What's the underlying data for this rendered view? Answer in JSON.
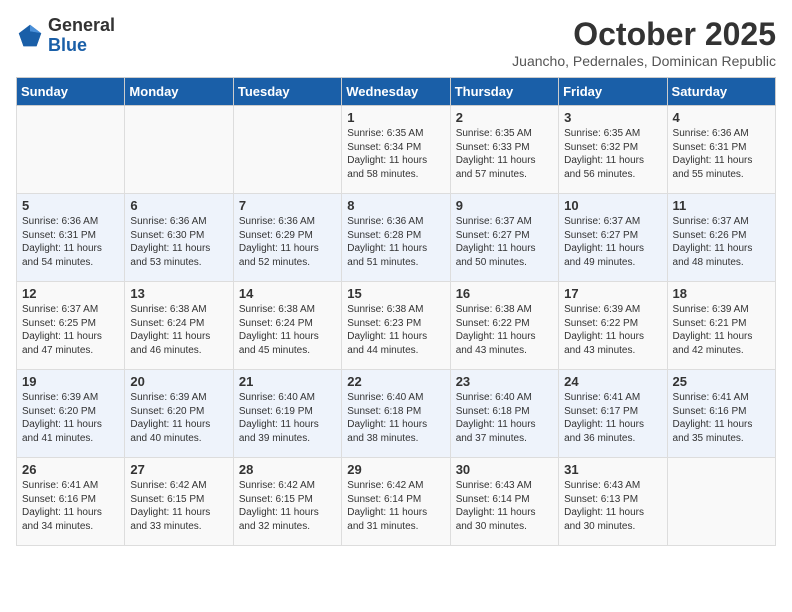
{
  "header": {
    "logo_general": "General",
    "logo_blue": "Blue",
    "month_title": "October 2025",
    "location": "Juancho, Pedernales, Dominican Republic"
  },
  "days_of_week": [
    "Sunday",
    "Monday",
    "Tuesday",
    "Wednesday",
    "Thursday",
    "Friday",
    "Saturday"
  ],
  "weeks": [
    [
      {
        "day": "",
        "info": ""
      },
      {
        "day": "",
        "info": ""
      },
      {
        "day": "",
        "info": ""
      },
      {
        "day": "1",
        "info": "Sunrise: 6:35 AM\nSunset: 6:34 PM\nDaylight: 11 hours\nand 58 minutes."
      },
      {
        "day": "2",
        "info": "Sunrise: 6:35 AM\nSunset: 6:33 PM\nDaylight: 11 hours\nand 57 minutes."
      },
      {
        "day": "3",
        "info": "Sunrise: 6:35 AM\nSunset: 6:32 PM\nDaylight: 11 hours\nand 56 minutes."
      },
      {
        "day": "4",
        "info": "Sunrise: 6:36 AM\nSunset: 6:31 PM\nDaylight: 11 hours\nand 55 minutes."
      }
    ],
    [
      {
        "day": "5",
        "info": "Sunrise: 6:36 AM\nSunset: 6:31 PM\nDaylight: 11 hours\nand 54 minutes."
      },
      {
        "day": "6",
        "info": "Sunrise: 6:36 AM\nSunset: 6:30 PM\nDaylight: 11 hours\nand 53 minutes."
      },
      {
        "day": "7",
        "info": "Sunrise: 6:36 AM\nSunset: 6:29 PM\nDaylight: 11 hours\nand 52 minutes."
      },
      {
        "day": "8",
        "info": "Sunrise: 6:36 AM\nSunset: 6:28 PM\nDaylight: 11 hours\nand 51 minutes."
      },
      {
        "day": "9",
        "info": "Sunrise: 6:37 AM\nSunset: 6:27 PM\nDaylight: 11 hours\nand 50 minutes."
      },
      {
        "day": "10",
        "info": "Sunrise: 6:37 AM\nSunset: 6:27 PM\nDaylight: 11 hours\nand 49 minutes."
      },
      {
        "day": "11",
        "info": "Sunrise: 6:37 AM\nSunset: 6:26 PM\nDaylight: 11 hours\nand 48 minutes."
      }
    ],
    [
      {
        "day": "12",
        "info": "Sunrise: 6:37 AM\nSunset: 6:25 PM\nDaylight: 11 hours\nand 47 minutes."
      },
      {
        "day": "13",
        "info": "Sunrise: 6:38 AM\nSunset: 6:24 PM\nDaylight: 11 hours\nand 46 minutes."
      },
      {
        "day": "14",
        "info": "Sunrise: 6:38 AM\nSunset: 6:24 PM\nDaylight: 11 hours\nand 45 minutes."
      },
      {
        "day": "15",
        "info": "Sunrise: 6:38 AM\nSunset: 6:23 PM\nDaylight: 11 hours\nand 44 minutes."
      },
      {
        "day": "16",
        "info": "Sunrise: 6:38 AM\nSunset: 6:22 PM\nDaylight: 11 hours\nand 43 minutes."
      },
      {
        "day": "17",
        "info": "Sunrise: 6:39 AM\nSunset: 6:22 PM\nDaylight: 11 hours\nand 43 minutes."
      },
      {
        "day": "18",
        "info": "Sunrise: 6:39 AM\nSunset: 6:21 PM\nDaylight: 11 hours\nand 42 minutes."
      }
    ],
    [
      {
        "day": "19",
        "info": "Sunrise: 6:39 AM\nSunset: 6:20 PM\nDaylight: 11 hours\nand 41 minutes."
      },
      {
        "day": "20",
        "info": "Sunrise: 6:39 AM\nSunset: 6:20 PM\nDaylight: 11 hours\nand 40 minutes."
      },
      {
        "day": "21",
        "info": "Sunrise: 6:40 AM\nSunset: 6:19 PM\nDaylight: 11 hours\nand 39 minutes."
      },
      {
        "day": "22",
        "info": "Sunrise: 6:40 AM\nSunset: 6:18 PM\nDaylight: 11 hours\nand 38 minutes."
      },
      {
        "day": "23",
        "info": "Sunrise: 6:40 AM\nSunset: 6:18 PM\nDaylight: 11 hours\nand 37 minutes."
      },
      {
        "day": "24",
        "info": "Sunrise: 6:41 AM\nSunset: 6:17 PM\nDaylight: 11 hours\nand 36 minutes."
      },
      {
        "day": "25",
        "info": "Sunrise: 6:41 AM\nSunset: 6:16 PM\nDaylight: 11 hours\nand 35 minutes."
      }
    ],
    [
      {
        "day": "26",
        "info": "Sunrise: 6:41 AM\nSunset: 6:16 PM\nDaylight: 11 hours\nand 34 minutes."
      },
      {
        "day": "27",
        "info": "Sunrise: 6:42 AM\nSunset: 6:15 PM\nDaylight: 11 hours\nand 33 minutes."
      },
      {
        "day": "28",
        "info": "Sunrise: 6:42 AM\nSunset: 6:15 PM\nDaylight: 11 hours\nand 32 minutes."
      },
      {
        "day": "29",
        "info": "Sunrise: 6:42 AM\nSunset: 6:14 PM\nDaylight: 11 hours\nand 31 minutes."
      },
      {
        "day": "30",
        "info": "Sunrise: 6:43 AM\nSunset: 6:14 PM\nDaylight: 11 hours\nand 30 minutes."
      },
      {
        "day": "31",
        "info": "Sunrise: 6:43 AM\nSunset: 6:13 PM\nDaylight: 11 hours\nand 30 minutes."
      },
      {
        "day": "",
        "info": ""
      }
    ]
  ]
}
